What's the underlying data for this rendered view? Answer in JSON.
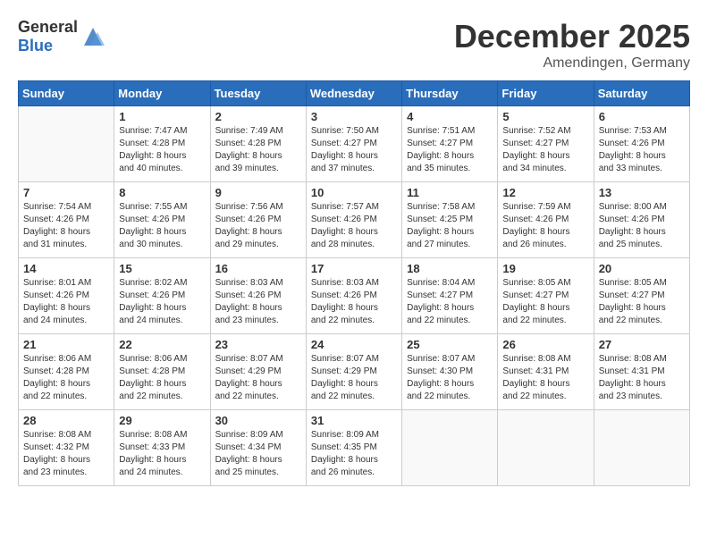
{
  "header": {
    "logo_general": "General",
    "logo_blue": "Blue",
    "month": "December 2025",
    "location": "Amendingen, Germany"
  },
  "days_of_week": [
    "Sunday",
    "Monday",
    "Tuesday",
    "Wednesday",
    "Thursday",
    "Friday",
    "Saturday"
  ],
  "weeks": [
    [
      {
        "day": "",
        "info": ""
      },
      {
        "day": "1",
        "info": "Sunrise: 7:47 AM\nSunset: 4:28 PM\nDaylight: 8 hours\nand 40 minutes."
      },
      {
        "day": "2",
        "info": "Sunrise: 7:49 AM\nSunset: 4:28 PM\nDaylight: 8 hours\nand 39 minutes."
      },
      {
        "day": "3",
        "info": "Sunrise: 7:50 AM\nSunset: 4:27 PM\nDaylight: 8 hours\nand 37 minutes."
      },
      {
        "day": "4",
        "info": "Sunrise: 7:51 AM\nSunset: 4:27 PM\nDaylight: 8 hours\nand 35 minutes."
      },
      {
        "day": "5",
        "info": "Sunrise: 7:52 AM\nSunset: 4:27 PM\nDaylight: 8 hours\nand 34 minutes."
      },
      {
        "day": "6",
        "info": "Sunrise: 7:53 AM\nSunset: 4:26 PM\nDaylight: 8 hours\nand 33 minutes."
      }
    ],
    [
      {
        "day": "7",
        "info": "Sunrise: 7:54 AM\nSunset: 4:26 PM\nDaylight: 8 hours\nand 31 minutes."
      },
      {
        "day": "8",
        "info": "Sunrise: 7:55 AM\nSunset: 4:26 PM\nDaylight: 8 hours\nand 30 minutes."
      },
      {
        "day": "9",
        "info": "Sunrise: 7:56 AM\nSunset: 4:26 PM\nDaylight: 8 hours\nand 29 minutes."
      },
      {
        "day": "10",
        "info": "Sunrise: 7:57 AM\nSunset: 4:26 PM\nDaylight: 8 hours\nand 28 minutes."
      },
      {
        "day": "11",
        "info": "Sunrise: 7:58 AM\nSunset: 4:25 PM\nDaylight: 8 hours\nand 27 minutes."
      },
      {
        "day": "12",
        "info": "Sunrise: 7:59 AM\nSunset: 4:26 PM\nDaylight: 8 hours\nand 26 minutes."
      },
      {
        "day": "13",
        "info": "Sunrise: 8:00 AM\nSunset: 4:26 PM\nDaylight: 8 hours\nand 25 minutes."
      }
    ],
    [
      {
        "day": "14",
        "info": "Sunrise: 8:01 AM\nSunset: 4:26 PM\nDaylight: 8 hours\nand 24 minutes."
      },
      {
        "day": "15",
        "info": "Sunrise: 8:02 AM\nSunset: 4:26 PM\nDaylight: 8 hours\nand 24 minutes."
      },
      {
        "day": "16",
        "info": "Sunrise: 8:03 AM\nSunset: 4:26 PM\nDaylight: 8 hours\nand 23 minutes."
      },
      {
        "day": "17",
        "info": "Sunrise: 8:03 AM\nSunset: 4:26 PM\nDaylight: 8 hours\nand 22 minutes."
      },
      {
        "day": "18",
        "info": "Sunrise: 8:04 AM\nSunset: 4:27 PM\nDaylight: 8 hours\nand 22 minutes."
      },
      {
        "day": "19",
        "info": "Sunrise: 8:05 AM\nSunset: 4:27 PM\nDaylight: 8 hours\nand 22 minutes."
      },
      {
        "day": "20",
        "info": "Sunrise: 8:05 AM\nSunset: 4:27 PM\nDaylight: 8 hours\nand 22 minutes."
      }
    ],
    [
      {
        "day": "21",
        "info": "Sunrise: 8:06 AM\nSunset: 4:28 PM\nDaylight: 8 hours\nand 22 minutes."
      },
      {
        "day": "22",
        "info": "Sunrise: 8:06 AM\nSunset: 4:28 PM\nDaylight: 8 hours\nand 22 minutes."
      },
      {
        "day": "23",
        "info": "Sunrise: 8:07 AM\nSunset: 4:29 PM\nDaylight: 8 hours\nand 22 minutes."
      },
      {
        "day": "24",
        "info": "Sunrise: 8:07 AM\nSunset: 4:29 PM\nDaylight: 8 hours\nand 22 minutes."
      },
      {
        "day": "25",
        "info": "Sunrise: 8:07 AM\nSunset: 4:30 PM\nDaylight: 8 hours\nand 22 minutes."
      },
      {
        "day": "26",
        "info": "Sunrise: 8:08 AM\nSunset: 4:31 PM\nDaylight: 8 hours\nand 22 minutes."
      },
      {
        "day": "27",
        "info": "Sunrise: 8:08 AM\nSunset: 4:31 PM\nDaylight: 8 hours\nand 23 minutes."
      }
    ],
    [
      {
        "day": "28",
        "info": "Sunrise: 8:08 AM\nSunset: 4:32 PM\nDaylight: 8 hours\nand 23 minutes."
      },
      {
        "day": "29",
        "info": "Sunrise: 8:08 AM\nSunset: 4:33 PM\nDaylight: 8 hours\nand 24 minutes."
      },
      {
        "day": "30",
        "info": "Sunrise: 8:09 AM\nSunset: 4:34 PM\nDaylight: 8 hours\nand 25 minutes."
      },
      {
        "day": "31",
        "info": "Sunrise: 8:09 AM\nSunset: 4:35 PM\nDaylight: 8 hours\nand 26 minutes."
      },
      {
        "day": "",
        "info": ""
      },
      {
        "day": "",
        "info": ""
      },
      {
        "day": "",
        "info": ""
      }
    ]
  ]
}
